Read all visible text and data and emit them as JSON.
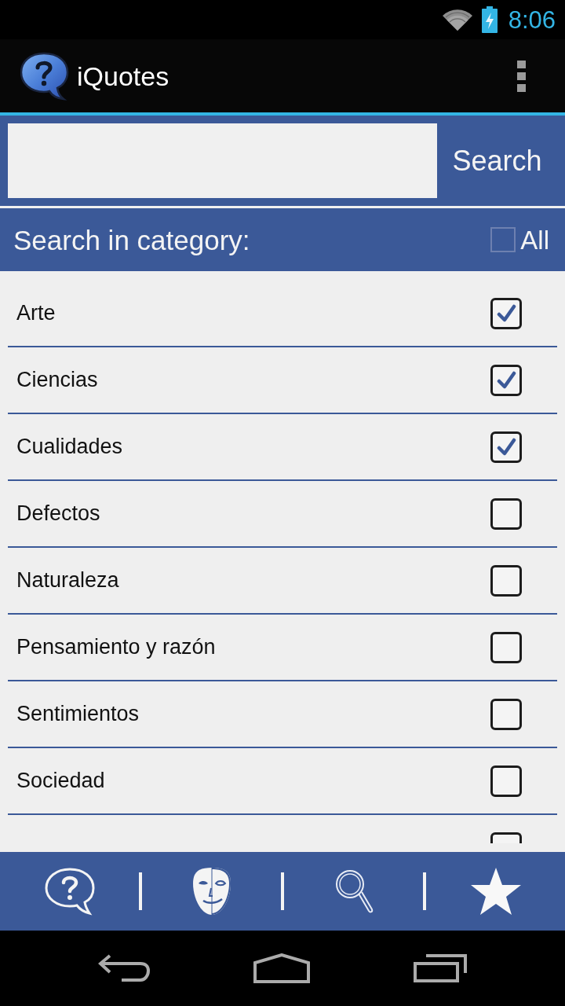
{
  "status_bar": {
    "time": "8:06"
  },
  "action_bar": {
    "title": "iQuotes"
  },
  "search": {
    "button": "Search"
  },
  "category_header": {
    "label": "Search in category:",
    "all_label": "All",
    "all_checked": false
  },
  "categories": [
    {
      "label": "Arte",
      "checked": true
    },
    {
      "label": "Ciencias",
      "checked": true
    },
    {
      "label": "Cualidades",
      "checked": true
    },
    {
      "label": "Defectos",
      "checked": false
    },
    {
      "label": "Naturaleza",
      "checked": false
    },
    {
      "label": "Pensamiento y razón",
      "checked": false
    },
    {
      "label": "Sentimientos",
      "checked": false
    },
    {
      "label": "Sociedad",
      "checked": false
    },
    {
      "checked": false
    }
  ]
}
